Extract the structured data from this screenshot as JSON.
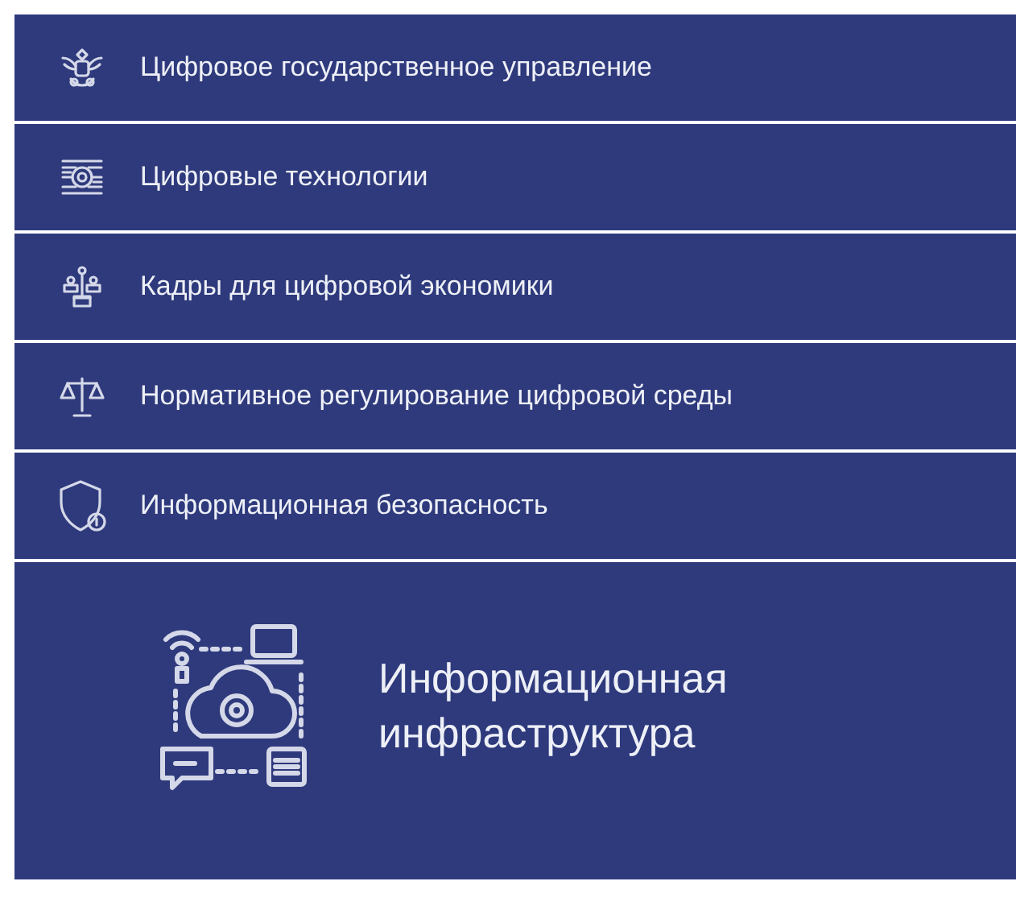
{
  "menu": [
    {
      "kind": "emblem",
      "label": "Цифровое государственное управление"
    },
    {
      "kind": "circuit",
      "label": "Цифровые технологии"
    },
    {
      "kind": "people",
      "label": "Кадры для цифровой экономики"
    },
    {
      "kind": "scales",
      "label": "Нормативное регулирование цифровой среды"
    },
    {
      "kind": "shield",
      "label": "Информационная безопасность"
    }
  ],
  "featured": {
    "kind": "cloud",
    "lines": [
      "Информационная",
      "инфраструктура"
    ]
  }
}
